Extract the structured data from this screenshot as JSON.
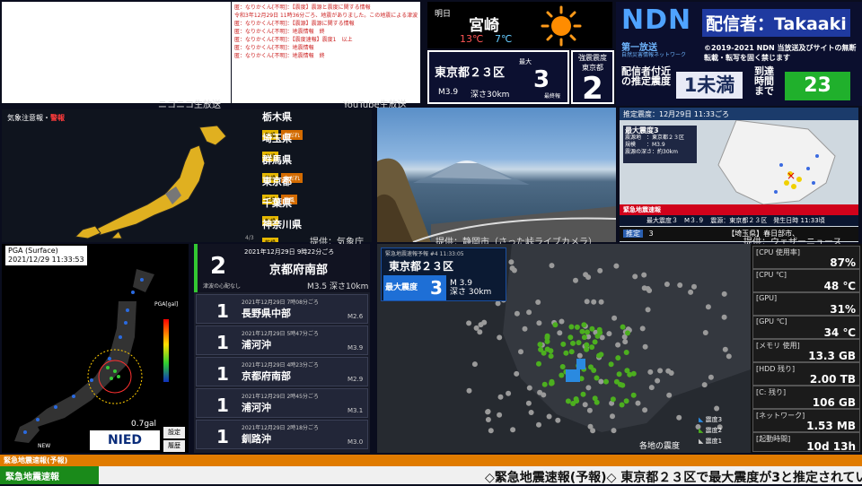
{
  "chat_right_lines": [
    "匿：なりかくん[不明]：【震度】震源と震度に関する情報",
    "令和3年12月29日 11時36分ごろ、地震がありました。この地震による津波の心配はありません。",
    "匿：なりかくん[不明]：【震源】震源に関する情報",
    "匿：なりかくん[不明]：地震情報　終",
    "匿：なりかくん[不明]：【震度速報】震度1　以上",
    "匿：なりかくん[不明]：地震情報",
    "匿：なりかくん[不明]：地震情報　終"
  ],
  "captions": {
    "niconico": "ニコニコ生放送",
    "youtube": "YouTube生放送",
    "jma": "提供：気象庁",
    "camera": "提供：静岡市（さった峠ライブカメラ）",
    "weathernews": "提供：ウェザーニュース"
  },
  "weather": {
    "day": "明日",
    "city": "宮崎",
    "high": "13℃",
    "low": "7℃",
    "icon": "sun-icon"
  },
  "intensity_box": {
    "location": "東京都２３区",
    "max_label": "最大",
    "max_value": "3",
    "final": "最終報",
    "magnitude": "M3.9",
    "depth": "深さ30km"
  },
  "strong_box": {
    "label1": "強震震度",
    "label2": "東京都",
    "value": "2"
  },
  "ndn": {
    "logo": "NDN",
    "caster": "配信者：Takaaki",
    "sub1": "第一放送",
    "sub2": "自然災害情報ネットワーク",
    "copyright": "©2019-2021 NDN 当放送及びサイトの無断転載・転写を固く禁じます",
    "est_label": "配信者付近の推定震度",
    "est_value": "1未満",
    "arrival_label": "到達時間まで",
    "arrival_value": "23"
  },
  "japan_map": {
    "title_prefix": "気象注意報・",
    "title_warn": "警報",
    "page": "4/3",
    "prefectures": [
      {
        "name": "栃木県",
        "tags": [
          {
            "t": "乾燥",
            "o": false
          },
          {
            "t": "なだれ",
            "o": true
          }
        ]
      },
      {
        "name": "埼玉県",
        "tags": [
          {
            "t": "乾燥",
            "o": false
          }
        ]
      },
      {
        "name": "群馬県",
        "tags": [
          {
            "t": "乾燥",
            "o": false
          },
          {
            "t": "なだれ",
            "o": true
          }
        ]
      },
      {
        "name": "東京都",
        "tags": [
          {
            "t": "乾燥",
            "o": false
          },
          {
            "t": "強風",
            "o": true
          }
        ]
      },
      {
        "name": "千葉県",
        "tags": [
          {
            "t": "乾燥",
            "o": false
          }
        ]
      },
      {
        "name": "神奈川県",
        "tags": [
          {
            "t": "乾燥",
            "o": false
          }
        ]
      }
    ]
  },
  "kr": {
    "header": "推定震度：12月29日 11:33ごろ",
    "box_title": "最大震度3",
    "box_lines": [
      "震源地　：東京都２３区",
      "規模　　：M3.9",
      "震源の深さ：約30km"
    ],
    "warn": "緊急地震速報",
    "info": "最大震度３　M３.９　震源：東京都２３区　発生日時 11:33頃",
    "bottom_label": "推定",
    "bottom_value": "3",
    "bottom_area": "【埼玉県】春日部市、"
  },
  "pga": {
    "title": "PGA (Surface)",
    "time": "2021/12/29 11:33:53",
    "max": "0.7gal",
    "logo": "NIED",
    "btn1": "設定",
    "btn2": "履歴",
    "new": "NEW",
    "scale_label": "PGA[gal]"
  },
  "eq_top": {
    "datetime": "2021年12月29日 9時22分ごろ",
    "int": "2",
    "place": "京都府南部",
    "tsunami": "津波の心配なし",
    "md": "M3.5 深さ10km"
  },
  "eq_list": [
    {
      "datetime": "2021年12月29日 7時08分ごろ",
      "int": "1",
      "place": "長野県中部",
      "mag": "M2.6"
    },
    {
      "datetime": "2021年12月29日 5時47分ごろ",
      "int": "1",
      "place": "浦河沖",
      "mag": "M3.9"
    },
    {
      "datetime": "2021年12月29日 4時23分ごろ",
      "int": "1",
      "place": "京都府南部",
      "mag": "M2.9"
    },
    {
      "datetime": "2021年12月29日 2時45分ごろ",
      "int": "1",
      "place": "浦河沖",
      "mag": "M3.1"
    },
    {
      "datetime": "2021年12月29日 2時18分ごろ",
      "int": "1",
      "place": "釧路沖",
      "mag": "M3.0"
    }
  ],
  "km": {
    "small": "緊急地震速報予報 #4 11:33:05",
    "place": "東京都２３区",
    "max_label": "最大震度",
    "max_value": "3",
    "mag": "M 3.9",
    "depth": "深さ 30km",
    "legend": [
      "震度3",
      "震度2",
      "震度1"
    ],
    "footer": "各地の震度"
  },
  "stats": [
    {
      "k": "[CPU 使用率]",
      "v": "87%"
    },
    {
      "k": "[CPU ℃]",
      "v": "48 ℃"
    },
    {
      "k": "[GPU]",
      "v": "31%"
    },
    {
      "k": "[GPU ℃]",
      "v": "34 ℃"
    },
    {
      "k": "[メモリ 使用]",
      "v": "13.3 GB"
    },
    {
      "k": "[HDD 残り]",
      "v": "2.00 TB"
    },
    {
      "k": "[C: 残り]",
      "v": "106 GB"
    },
    {
      "k": "[ネットワーク]",
      "v": "1.53 MB"
    },
    {
      "k": "[起動時間]",
      "v": "10d 13h"
    }
  ],
  "bottom": {
    "bar1": "緊急地震速報(予報)",
    "label": "緊急地震速報",
    "ticker": "◇緊急地震速報(予報)◇ 東京都２３区で最大震度が3と推定されています"
  }
}
